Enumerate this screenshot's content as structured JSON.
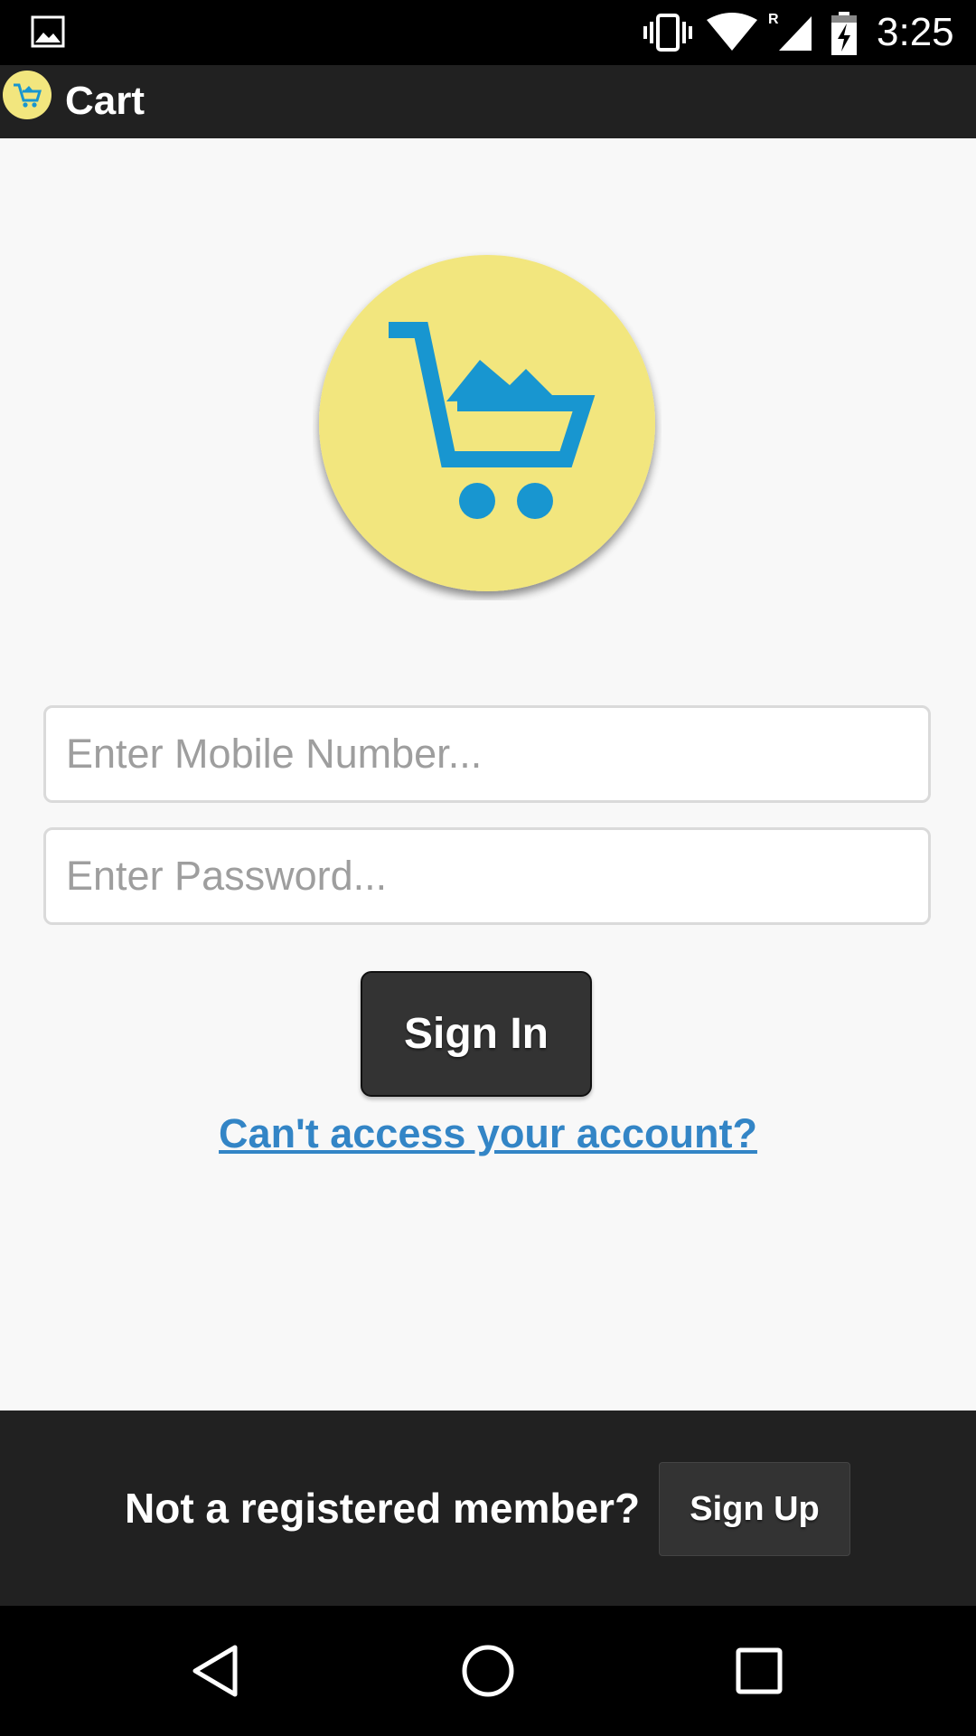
{
  "status_bar": {
    "time": "3:25",
    "icons": [
      "gallery-icon",
      "vibrate-icon",
      "wifi-icon",
      "signal-icon",
      "battery-charging-icon"
    ],
    "roaming_indicator": "R"
  },
  "app_bar": {
    "title": "Cart",
    "icon": "cart-icon"
  },
  "logo": {
    "icon": "cart-icon",
    "background_color": "#f2e67e",
    "icon_color": "#1896d0"
  },
  "login_form": {
    "mobile_placeholder": "Enter Mobile Number...",
    "mobile_value": "",
    "password_placeholder": "Enter Password...",
    "password_value": "",
    "sign_in_label": "Sign In",
    "forgot_link": "Can't access your account?"
  },
  "footer": {
    "prompt": "Not a registered member?",
    "sign_up_label": "Sign Up"
  },
  "nav_bar": {
    "buttons": [
      "back-icon",
      "home-icon",
      "recents-icon"
    ]
  },
  "colors": {
    "accent_link": "#3385c6",
    "dark_bar": "#212121",
    "button": "#333333",
    "background": "#f8f8f8"
  }
}
